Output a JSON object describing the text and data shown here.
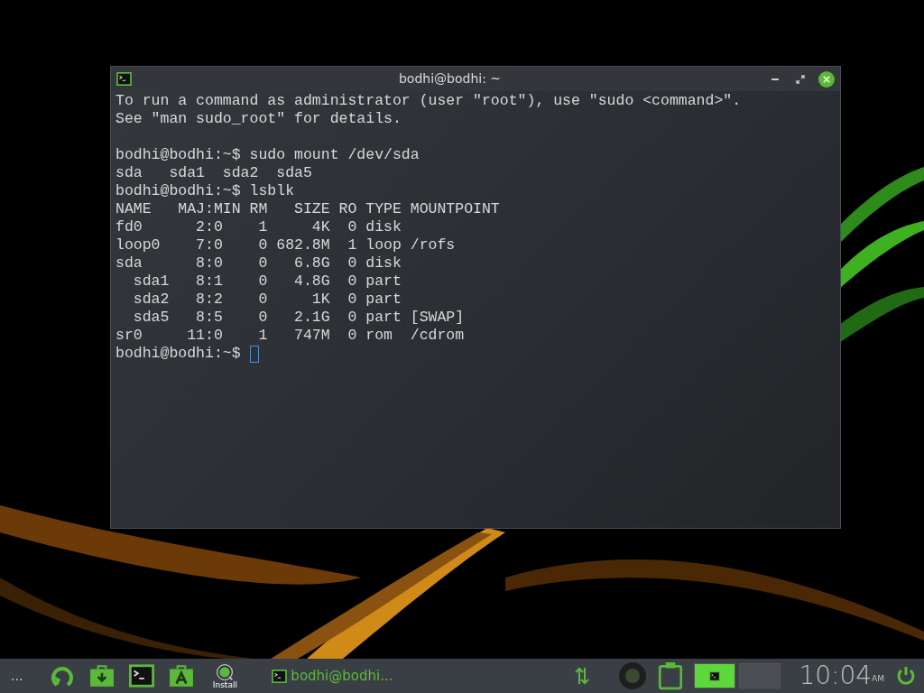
{
  "window": {
    "title": "bodhi@bodhi: ~"
  },
  "terminal": {
    "blocks": [
      [
        "To run a command as administrator (user \"root\"), use \"sudo <command>\".",
        "See \"man sudo_root\" for details."
      ],
      [
        "bodhi@bodhi:~$ sudo mount /dev/sda",
        "sda   sda1  sda2  sda5",
        "bodhi@bodhi:~$ lsblk",
        "NAME   MAJ:MIN RM   SIZE RO TYPE MOUNTPOINT",
        "fd0      2:0    1     4K  0 disk",
        "loop0    7:0    0 682.8M  1 loop /rofs",
        "sda      8:0    0   6.8G  0 disk",
        "  sda1   8:1    0   4.8G  0 part",
        "  sda2   8:2    0     1K  0 part",
        "  sda5   8:5    0   2.1G  0 part [SWAP]",
        "sr0     11:0    1   747M  0 rom  /cdrom"
      ]
    ],
    "prompt": "bodhi@bodhi:~$ "
  },
  "taskbar": {
    "menu": "...",
    "launchers": [
      {
        "kind": "refresh"
      },
      {
        "kind": "download"
      },
      {
        "kind": "terminal"
      },
      {
        "kind": "appstore"
      },
      {
        "kind": "installer",
        "label": "Install"
      }
    ],
    "tasks": [
      {
        "label": "bodhi@bodhi...",
        "selected": false
      }
    ],
    "workspaces": [
      {
        "selected": true
      },
      {
        "selected": false
      }
    ],
    "clock": {
      "time": "10:04",
      "period": "AM"
    }
  }
}
